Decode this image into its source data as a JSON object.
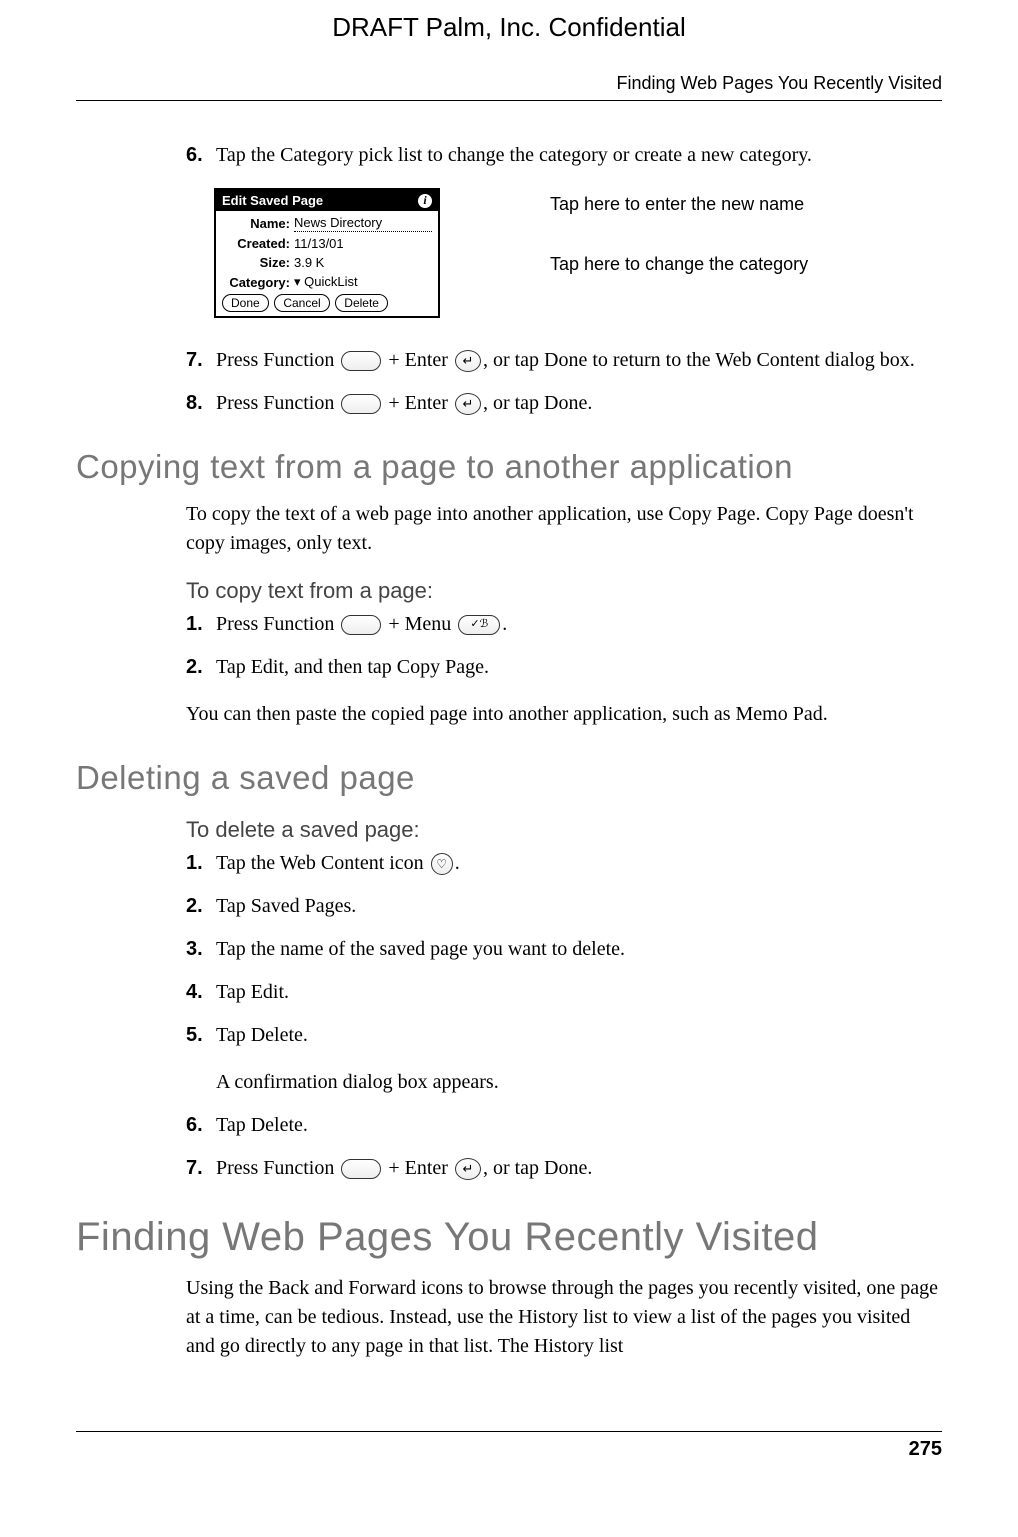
{
  "header": {
    "draft": "DRAFT   Palm, Inc. Confidential",
    "running_head": "Finding Web Pages You Recently Visited"
  },
  "step6": {
    "num": "6.",
    "text": "Tap the Category pick list to change the category or create a new category."
  },
  "figure": {
    "title": "Edit Saved Page",
    "info_glyph": "i",
    "name_label": "Name:",
    "name_value": "News Directory",
    "created_label": "Created:",
    "created_value": "11/13/01",
    "size_label": "Size:",
    "size_value": "3.9 K",
    "category_label": "Category:",
    "category_value": "QuickList",
    "btn_done": "Done",
    "btn_cancel": "Cancel",
    "btn_delete": "Delete",
    "callout_name": "Tap here to enter the new name",
    "callout_cat": "Tap here to change the category"
  },
  "step7": {
    "num": "7.",
    "pre": "Press Function ",
    "mid": " + Enter ",
    "post": ", or tap Done to return to the Web Content dialog box."
  },
  "step8": {
    "num": "8.",
    "pre": "Press Function ",
    "mid": " + Enter ",
    "post": ", or tap Done."
  },
  "sec_copy": {
    "heading": "Copying text from a page to another application",
    "para": "To copy the text of a web page into another application, use Copy Page. Copy Page doesn't copy images, only text.",
    "sub": "To copy text from a page:",
    "s1_num": "1.",
    "s1_pre": "Press Function ",
    "s1_mid": " + Menu ",
    "s1_post": ".",
    "s2_num": "2.",
    "s2_text": "Tap Edit, and then tap Copy Page.",
    "after": "You can then paste the copied page into another application, such as Memo Pad."
  },
  "sec_del": {
    "heading": "Deleting a saved page",
    "sub": "To delete a saved page:",
    "s1_num": "1.",
    "s1_pre": "Tap the Web Content icon ",
    "s1_post": ".",
    "s2_num": "2.",
    "s2_text": "Tap Saved Pages.",
    "s3_num": "3.",
    "s3_text": "Tap the name of the saved page you want to delete.",
    "s4_num": "4.",
    "s4_text": "Tap Edit.",
    "s5_num": "5.",
    "s5_text": "Tap Delete.",
    "s5_after": "A confirmation dialog box appears.",
    "s6_num": "6.",
    "s6_text": "Tap Delete.",
    "s7_num": "7.",
    "s7_pre": "Press Function ",
    "s7_mid": " + Enter ",
    "s7_post": ", or tap Done."
  },
  "sec_find": {
    "heading": "Finding Web Pages You Recently Visited",
    "para": "Using the Back and Forward icons to browse through the pages you recently visited, one page at a time, can be tedious. Instead, use the History list to view a list of the pages you visited and go directly to any page in that list. The History list"
  },
  "icons": {
    "enter_glyph": "↵",
    "menu_glyph": "✓ℬ",
    "heart_glyph": "♡"
  },
  "footer": {
    "page": "275"
  }
}
